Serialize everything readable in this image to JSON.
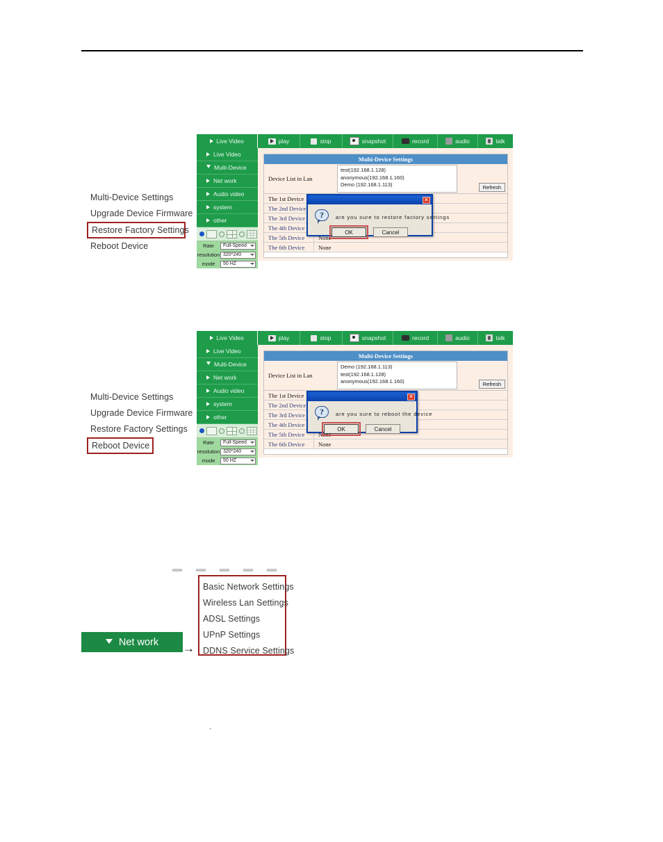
{
  "toolbar": {
    "items": [
      {
        "label": "Live Video",
        "icon": "play-triangle-icon"
      },
      {
        "label": "play",
        "icon": "play-icon"
      },
      {
        "label": "stop",
        "icon": "stop-icon"
      },
      {
        "label": "snapshot",
        "icon": "camera-icon"
      },
      {
        "label": "record",
        "icon": "record-icon"
      },
      {
        "label": "audio",
        "icon": "audio-icon"
      },
      {
        "label": "talk",
        "icon": "talk-icon"
      }
    ]
  },
  "sidebar": {
    "items": [
      {
        "label": "Live Video",
        "state": "collapsed"
      },
      {
        "label": "Multi-Device",
        "state": "expanded"
      },
      {
        "label": "Net work",
        "state": "collapsed"
      },
      {
        "label": "Audio video",
        "state": "collapsed"
      },
      {
        "label": "system",
        "state": "collapsed"
      },
      {
        "label": "other",
        "state": "collapsed"
      }
    ],
    "controls": {
      "rate_label": "Rate",
      "rate_value": "Full-Speed",
      "resolution_label": "resolution",
      "resolution_value": "320*240",
      "mode_label": "mode",
      "mode_value": "50 HZ"
    }
  },
  "shot1": {
    "table_title": "Multi-Device Settings",
    "device_list_label": "Device List in Lan",
    "device_list": [
      "test(192.168.1.128)",
      "anonymous(192.168.1.160)",
      "Demo (192.168.1.113)"
    ],
    "refresh_label": "Refresh",
    "rows": [
      {
        "name": "The 1st Device",
        "value": ""
      },
      {
        "name": "The 2nd Device",
        "value": ""
      },
      {
        "name": "The 3rd Device",
        "value": ""
      },
      {
        "name": "The 4th Device",
        "value": ""
      },
      {
        "name": "The 5th Device",
        "value": "None"
      },
      {
        "name": "The 6th Device",
        "value": "None"
      }
    ],
    "dialog": {
      "message": "are you sure to restore factory settings",
      "ok_label": "OK",
      "cancel_label": "Cancel",
      "close_label": "✕",
      "icon": "question-mark-icon"
    },
    "annotations": [
      "Multi-Device Settings",
      "Upgrade Device Firmware",
      "Restore Factory Settings",
      "Reboot Device"
    ],
    "highlighted_annotation": "Restore Factory Settings"
  },
  "shot2": {
    "table_title": "Multi-Device Settings",
    "device_list_label": "Device List in Lan",
    "device_list": [
      "Demo (192.168.1.113)",
      "test(192.168.1.128)",
      "anonymous(192.168.1.160)"
    ],
    "refresh_label": "Refresh",
    "rows": [
      {
        "name": "The 1st Device",
        "value": ""
      },
      {
        "name": "The 2nd Device",
        "value": ""
      },
      {
        "name": "The 3rd Device",
        "value": ""
      },
      {
        "name": "The 4th Device",
        "value": ""
      },
      {
        "name": "The 5th Device",
        "value": "None"
      },
      {
        "name": "The 6th Device",
        "value": "None"
      }
    ],
    "dialog": {
      "message": "are you sure to reboot the device",
      "ok_label": "OK",
      "cancel_label": "Cancel",
      "close_label": "✕",
      "icon": "question-mark-icon"
    },
    "annotations": [
      "Multi-Device Settings",
      "Upgrade Device Firmware",
      "Restore Factory Settings",
      "Reboot Device"
    ],
    "highlighted_annotation": "Reboot Device"
  },
  "network_section": {
    "button_label": "Net work",
    "arrow": "→",
    "menu_items": [
      "Basic Network Settings",
      "Wireless Lan Settings",
      "ADSL Settings",
      "UPnP Settings",
      "DDNS Service Settings"
    ]
  },
  "colors": {
    "green": "#1e9c4a",
    "dark_green": "#1c8a44",
    "highlight_red": "#9e2020",
    "table_header_blue": "#4e8fc7",
    "panel_bg": "#fdeee4",
    "dialog_title_blue": "#0a41ad"
  }
}
